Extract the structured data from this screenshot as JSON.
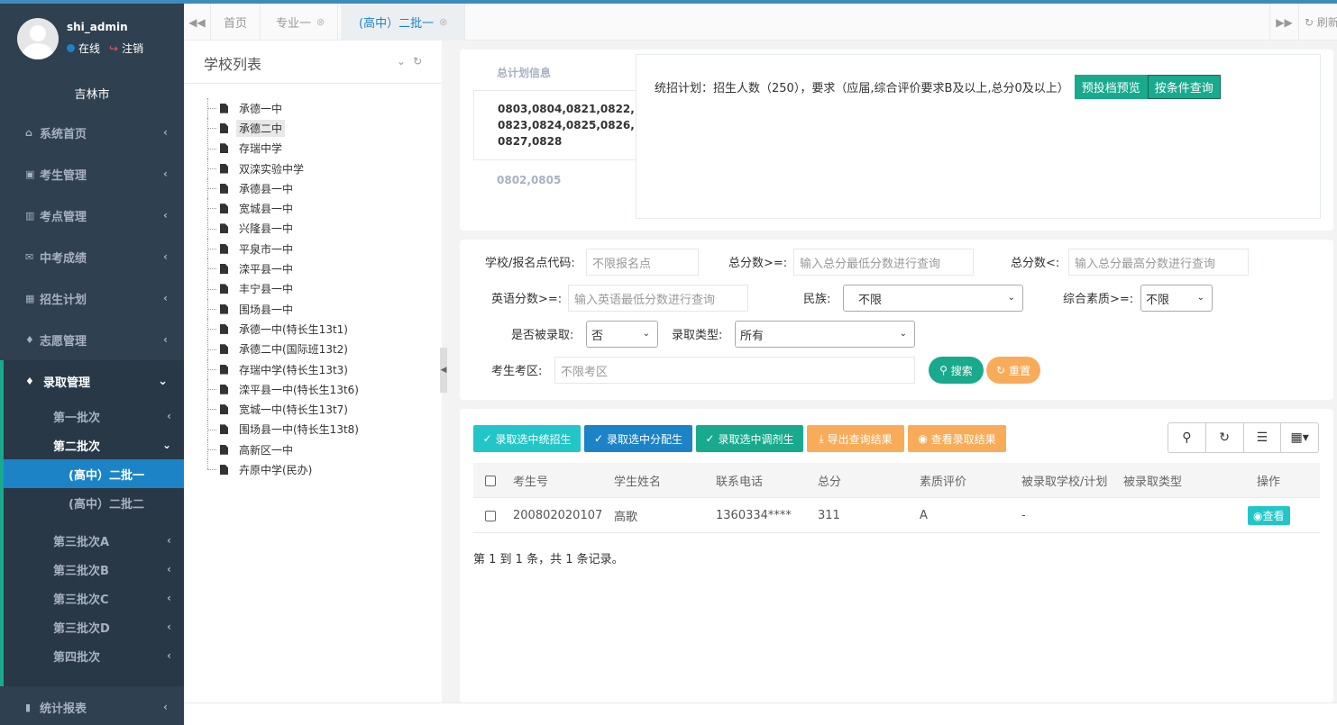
{
  "user": {
    "name": "shi_admin",
    "status": "在线",
    "logout": "注销"
  },
  "city": "吉林市",
  "nav": {
    "home": "系统首页",
    "students": "考生管理",
    "sites": "考点管理",
    "scores": "中考成绩",
    "plan": "招生计划",
    "wish": "志愿管理",
    "admission": "录取管理",
    "batch1": "第一批次",
    "batch2": "第二批次",
    "batch2_1": "(高中）二批一",
    "batch2_2": "(高中）二批二",
    "batch3a": "第三批次A",
    "batch3b": "第三批次B",
    "batch3c": "第三批次C",
    "batch3d": "第三批次D",
    "batch4": "第四批次",
    "stats": "统计报表"
  },
  "tabs": {
    "home": "首页",
    "major1": "专业一",
    "active": "(高中）二批一",
    "refresh": "刷新"
  },
  "tree": {
    "title": "学校列表",
    "nodes": [
      "承德一中",
      "承德二中",
      "存瑞中学",
      "双滦实验中学",
      "承德县一中",
      "宽城县一中",
      "兴隆县一中",
      "平泉市一中",
      "滦平县一中",
      "丰宁县一中",
      "围场县一中",
      "承德一中(特长生13t1)",
      "承德二中(国际班13t2)",
      "存瑞中学(特长生13t3)",
      "滦平县一中(特长生13t6)",
      "宽城一中(特长生13t7)",
      "围场县一中(特长生13t8)",
      "高新区一中",
      "卉原中学(民办)"
    ]
  },
  "plan": {
    "tab_total": "总计划信息",
    "tab_codes1": "0803,0804,0821,0822,\n0823,0824,0825,0826,\n0827,0828",
    "tab_codes2": "0802,0805",
    "summary": "统招计划：招生人数（250），要求（应届,综合评价要求B及以上,总分0及以上）",
    "btn_preview": "预投档预览",
    "btn_query": "按条件查询"
  },
  "filters": {
    "school_label": "学校/报名点代码:",
    "school_placeholder": "不限报名点",
    "min_total_label": "总分数>=:",
    "min_total_placeholder": "输入总分最低分数进行查询",
    "max_total_label": "总分数<:",
    "max_total_placeholder": "输入总分最高分数进行查询",
    "english_label": "英语分数>=:",
    "english_placeholder": "输入英语最低分数进行查询",
    "ethnic_label": "民族:",
    "ethnic_value": "不限",
    "quality_label": "综合素质>=:",
    "quality_value": "不限",
    "admitted_label": "是否被录取:",
    "admitted_value": "否",
    "type_label": "录取类型:",
    "type_value": "所有",
    "district_label": "考生考区:",
    "district_placeholder": "不限考区",
    "search": "搜索",
    "reset": "重置"
  },
  "toolbar": {
    "admit_unified": "录取选中统招生",
    "admit_allocated": "录取选中分配生",
    "admit_adjusted": "录取选中调剂生",
    "export": "导出查询结果",
    "view_results": "查看录取结果"
  },
  "table": {
    "headers": [
      "考生号",
      "学生姓名",
      "联系电话",
      "总分",
      "素质评价",
      "被录取学校/计划",
      "被录取类型",
      "操作"
    ],
    "rows": [
      {
        "id": "200802020107",
        "name": "高歌",
        "phone": "1360334****",
        "total": "311",
        "quality": "A",
        "school": "-",
        "type": "",
        "action": "查看"
      }
    ]
  },
  "pager": "第 1 到 1 条，共 1 条记录。"
}
